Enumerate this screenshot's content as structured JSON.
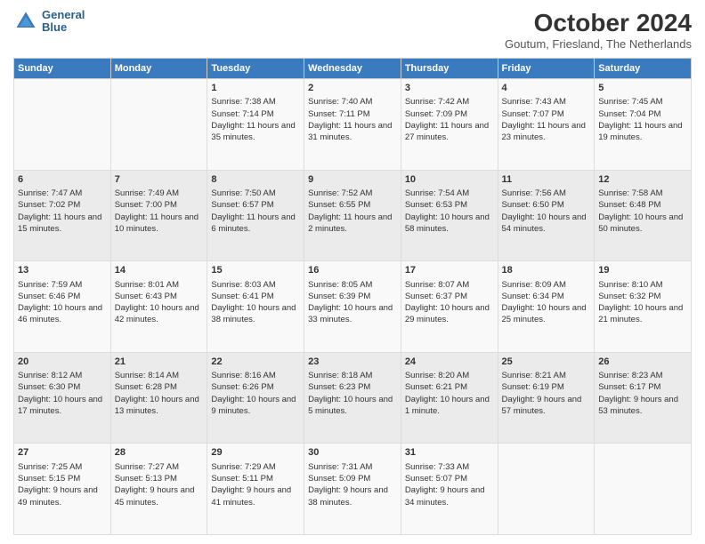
{
  "header": {
    "logo_line1": "General",
    "logo_line2": "Blue",
    "title": "October 2024",
    "subtitle": "Goutum, Friesland, The Netherlands"
  },
  "weekdays": [
    "Sunday",
    "Monday",
    "Tuesday",
    "Wednesday",
    "Thursday",
    "Friday",
    "Saturday"
  ],
  "weeks": [
    [
      {
        "day": "",
        "sunrise": "",
        "sunset": "",
        "daylight": ""
      },
      {
        "day": "",
        "sunrise": "",
        "sunset": "",
        "daylight": ""
      },
      {
        "day": "1",
        "sunrise": "Sunrise: 7:38 AM",
        "sunset": "Sunset: 7:14 PM",
        "daylight": "Daylight: 11 hours and 35 minutes."
      },
      {
        "day": "2",
        "sunrise": "Sunrise: 7:40 AM",
        "sunset": "Sunset: 7:11 PM",
        "daylight": "Daylight: 11 hours and 31 minutes."
      },
      {
        "day": "3",
        "sunrise": "Sunrise: 7:42 AM",
        "sunset": "Sunset: 7:09 PM",
        "daylight": "Daylight: 11 hours and 27 minutes."
      },
      {
        "day": "4",
        "sunrise": "Sunrise: 7:43 AM",
        "sunset": "Sunset: 7:07 PM",
        "daylight": "Daylight: 11 hours and 23 minutes."
      },
      {
        "day": "5",
        "sunrise": "Sunrise: 7:45 AM",
        "sunset": "Sunset: 7:04 PM",
        "daylight": "Daylight: 11 hours and 19 minutes."
      }
    ],
    [
      {
        "day": "6",
        "sunrise": "Sunrise: 7:47 AM",
        "sunset": "Sunset: 7:02 PM",
        "daylight": "Daylight: 11 hours and 15 minutes."
      },
      {
        "day": "7",
        "sunrise": "Sunrise: 7:49 AM",
        "sunset": "Sunset: 7:00 PM",
        "daylight": "Daylight: 11 hours and 10 minutes."
      },
      {
        "day": "8",
        "sunrise": "Sunrise: 7:50 AM",
        "sunset": "Sunset: 6:57 PM",
        "daylight": "Daylight: 11 hours and 6 minutes."
      },
      {
        "day": "9",
        "sunrise": "Sunrise: 7:52 AM",
        "sunset": "Sunset: 6:55 PM",
        "daylight": "Daylight: 11 hours and 2 minutes."
      },
      {
        "day": "10",
        "sunrise": "Sunrise: 7:54 AM",
        "sunset": "Sunset: 6:53 PM",
        "daylight": "Daylight: 10 hours and 58 minutes."
      },
      {
        "day": "11",
        "sunrise": "Sunrise: 7:56 AM",
        "sunset": "Sunset: 6:50 PM",
        "daylight": "Daylight: 10 hours and 54 minutes."
      },
      {
        "day": "12",
        "sunrise": "Sunrise: 7:58 AM",
        "sunset": "Sunset: 6:48 PM",
        "daylight": "Daylight: 10 hours and 50 minutes."
      }
    ],
    [
      {
        "day": "13",
        "sunrise": "Sunrise: 7:59 AM",
        "sunset": "Sunset: 6:46 PM",
        "daylight": "Daylight: 10 hours and 46 minutes."
      },
      {
        "day": "14",
        "sunrise": "Sunrise: 8:01 AM",
        "sunset": "Sunset: 6:43 PM",
        "daylight": "Daylight: 10 hours and 42 minutes."
      },
      {
        "day": "15",
        "sunrise": "Sunrise: 8:03 AM",
        "sunset": "Sunset: 6:41 PM",
        "daylight": "Daylight: 10 hours and 38 minutes."
      },
      {
        "day": "16",
        "sunrise": "Sunrise: 8:05 AM",
        "sunset": "Sunset: 6:39 PM",
        "daylight": "Daylight: 10 hours and 33 minutes."
      },
      {
        "day": "17",
        "sunrise": "Sunrise: 8:07 AM",
        "sunset": "Sunset: 6:37 PM",
        "daylight": "Daylight: 10 hours and 29 minutes."
      },
      {
        "day": "18",
        "sunrise": "Sunrise: 8:09 AM",
        "sunset": "Sunset: 6:34 PM",
        "daylight": "Daylight: 10 hours and 25 minutes."
      },
      {
        "day": "19",
        "sunrise": "Sunrise: 8:10 AM",
        "sunset": "Sunset: 6:32 PM",
        "daylight": "Daylight: 10 hours and 21 minutes."
      }
    ],
    [
      {
        "day": "20",
        "sunrise": "Sunrise: 8:12 AM",
        "sunset": "Sunset: 6:30 PM",
        "daylight": "Daylight: 10 hours and 17 minutes."
      },
      {
        "day": "21",
        "sunrise": "Sunrise: 8:14 AM",
        "sunset": "Sunset: 6:28 PM",
        "daylight": "Daylight: 10 hours and 13 minutes."
      },
      {
        "day": "22",
        "sunrise": "Sunrise: 8:16 AM",
        "sunset": "Sunset: 6:26 PM",
        "daylight": "Daylight: 10 hours and 9 minutes."
      },
      {
        "day": "23",
        "sunrise": "Sunrise: 8:18 AM",
        "sunset": "Sunset: 6:23 PM",
        "daylight": "Daylight: 10 hours and 5 minutes."
      },
      {
        "day": "24",
        "sunrise": "Sunrise: 8:20 AM",
        "sunset": "Sunset: 6:21 PM",
        "daylight": "Daylight: 10 hours and 1 minute."
      },
      {
        "day": "25",
        "sunrise": "Sunrise: 8:21 AM",
        "sunset": "Sunset: 6:19 PM",
        "daylight": "Daylight: 9 hours and 57 minutes."
      },
      {
        "day": "26",
        "sunrise": "Sunrise: 8:23 AM",
        "sunset": "Sunset: 6:17 PM",
        "daylight": "Daylight: 9 hours and 53 minutes."
      }
    ],
    [
      {
        "day": "27",
        "sunrise": "Sunrise: 7:25 AM",
        "sunset": "Sunset: 5:15 PM",
        "daylight": "Daylight: 9 hours and 49 minutes."
      },
      {
        "day": "28",
        "sunrise": "Sunrise: 7:27 AM",
        "sunset": "Sunset: 5:13 PM",
        "daylight": "Daylight: 9 hours and 45 minutes."
      },
      {
        "day": "29",
        "sunrise": "Sunrise: 7:29 AM",
        "sunset": "Sunset: 5:11 PM",
        "daylight": "Daylight: 9 hours and 41 minutes."
      },
      {
        "day": "30",
        "sunrise": "Sunrise: 7:31 AM",
        "sunset": "Sunset: 5:09 PM",
        "daylight": "Daylight: 9 hours and 38 minutes."
      },
      {
        "day": "31",
        "sunrise": "Sunrise: 7:33 AM",
        "sunset": "Sunset: 5:07 PM",
        "daylight": "Daylight: 9 hours and 34 minutes."
      },
      {
        "day": "",
        "sunrise": "",
        "sunset": "",
        "daylight": ""
      },
      {
        "day": "",
        "sunrise": "",
        "sunset": "",
        "daylight": ""
      }
    ]
  ]
}
